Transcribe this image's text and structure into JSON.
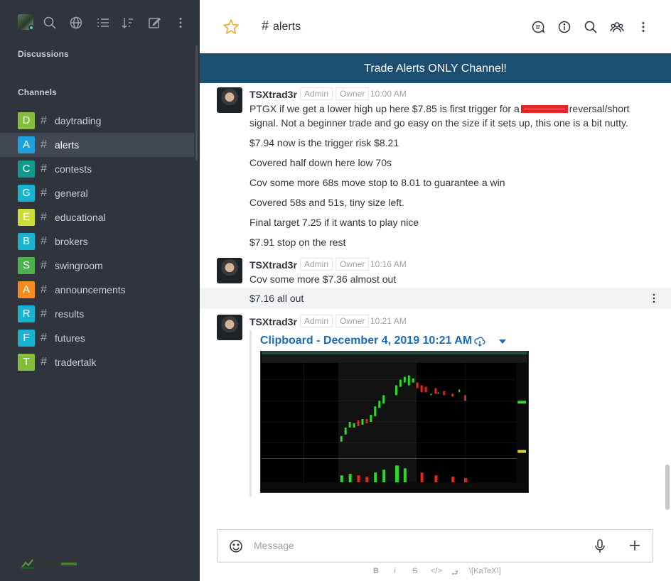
{
  "sidebar": {
    "sections": {
      "discussions": "Discussions",
      "channels": "Channels"
    },
    "top_icons": [
      "search-icon",
      "globe-icon",
      "list-icon",
      "sort-icon",
      "edit-icon",
      "kebab-icon"
    ],
    "channels": [
      {
        "letter": "D",
        "hash": "#",
        "label": "daytrading",
        "color": "#83bd3a"
      },
      {
        "letter": "A",
        "hash": "#",
        "label": "alerts",
        "color": "#1ca1e1",
        "active": true
      },
      {
        "letter": "C",
        "hash": "#",
        "label": "contests",
        "color": "#11998e"
      },
      {
        "letter": "G",
        "hash": "#",
        "label": "general",
        "color": "#17b3cf"
      },
      {
        "letter": "E",
        "hash": "#",
        "label": "educational",
        "color": "#cddc39"
      },
      {
        "letter": "B",
        "hash": "#",
        "label": "brokers",
        "color": "#17b3cf"
      },
      {
        "letter": "S",
        "hash": "#",
        "label": "swingroom",
        "color": "#4caf50"
      },
      {
        "letter": "A",
        "hash": "#",
        "label": "announcements",
        "color": "#f58c1c"
      },
      {
        "letter": "R",
        "hash": "#",
        "label": "results",
        "color": "#17b3cf"
      },
      {
        "letter": "F",
        "hash": "#",
        "label": "futures",
        "color": "#17b3cf"
      },
      {
        "letter": "T",
        "hash": "#",
        "label": "tradertalk",
        "color": "#83bd3a"
      }
    ]
  },
  "header": {
    "hash": "#",
    "channel_name": "alerts",
    "icons": [
      "threads-icon",
      "info-icon",
      "search-icon",
      "members-icon",
      "kebab-icon"
    ]
  },
  "banner": {
    "text": "Trade Alerts ONLY Channel!"
  },
  "messages": {
    "group1": {
      "user": "TSXtrad3r",
      "role1": "Admin",
      "role2": "Owner",
      "time": "10:00 AM",
      "text_a": "PTGX if we get a lower high up here $7.85 is first trigger for a",
      "text_b": "reversal/short",
      "text_c": "signal. Not a beginner trade and go easy on the size if it sets up, this one is a bit nutty.",
      "lines": [
        "$7.94 now is the trigger risk $8.21",
        "Covered half down here low 70s",
        "Cov some more 68s move stop to 8.01 to guarantee a win",
        "Covered 58s and 51s, tiny size left.",
        "Final target 7.25 if it wants to play nice",
        "$7.91 stop on the rest"
      ]
    },
    "group2": {
      "user": "TSXtrad3r",
      "role1": "Admin",
      "role2": "Owner",
      "time": "10:16 AM",
      "lines": [
        "Cov some more $7.36 almost out",
        "$7.16 all out"
      ]
    },
    "group3": {
      "user": "TSXtrad3r",
      "role1": "Admin",
      "role2": "Owner",
      "time": "10:21 AM",
      "attachment_title": "Clipboard - December 4, 2019 10:21 AM"
    }
  },
  "composer": {
    "placeholder": "Message",
    "format": {
      "bold": "B",
      "italic": "i",
      "strike": "S",
      "code": "</>",
      "enter": "⮐",
      "katex": "\\[KaTeX\\]"
    }
  }
}
